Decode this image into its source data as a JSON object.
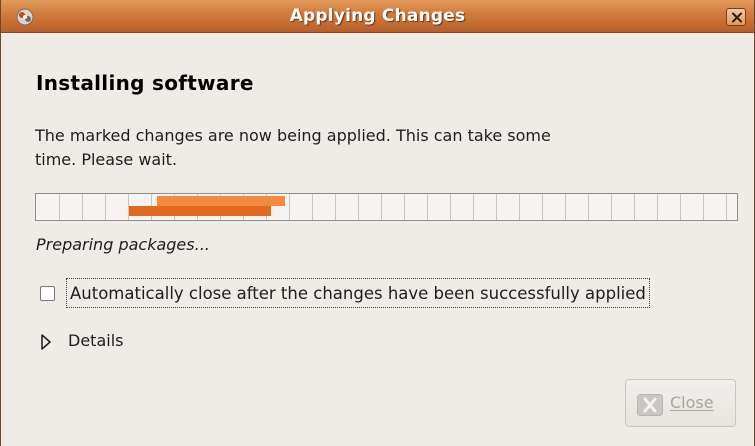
{
  "window": {
    "title": "Applying Changes",
    "app_icon": "package-manager-icon",
    "close_icon": "close-icon"
  },
  "main": {
    "heading": "Installing software",
    "description": "The marked changes are now being applied. This can take some time. Please wait.",
    "progress_style": "indeterminate-pulse",
    "status": "Preparing packages...",
    "auto_close": {
      "label": "Automatically close after the changes have been successfully applied",
      "checked": false
    },
    "details": {
      "label": "Details",
      "expanded": false,
      "icon": "expander-arrow-right-icon"
    },
    "close_button": {
      "label": "Close",
      "enabled": false,
      "icon": "close-x-icon"
    }
  },
  "colors": {
    "titlebar": "#d07a3c",
    "progress_fill_light": "#f58a3e",
    "progress_fill_dark": "#e26a1c",
    "window_bg": "#efebe7"
  }
}
